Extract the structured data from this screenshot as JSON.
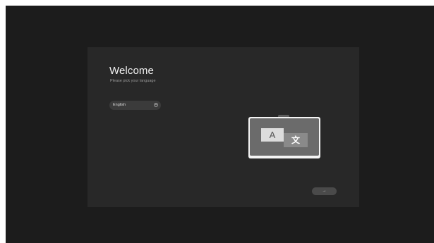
{
  "welcome": {
    "title": "Welcome",
    "subtitle": "Please pick your language"
  },
  "language_select": {
    "selected": "English",
    "icon": "chevron-down-circle-icon"
  },
  "illustration": {
    "latin_glyph": "A",
    "cjk_glyph": "文",
    "icon": "language-translation-icon"
  },
  "next_button": {
    "label": "→",
    "icon": "arrow-right-icon"
  },
  "colors": {
    "background": "#1c1c1c",
    "panel": "#282828",
    "text_primary": "#f2f2f2",
    "text_secondary": "#9a9a9a"
  }
}
